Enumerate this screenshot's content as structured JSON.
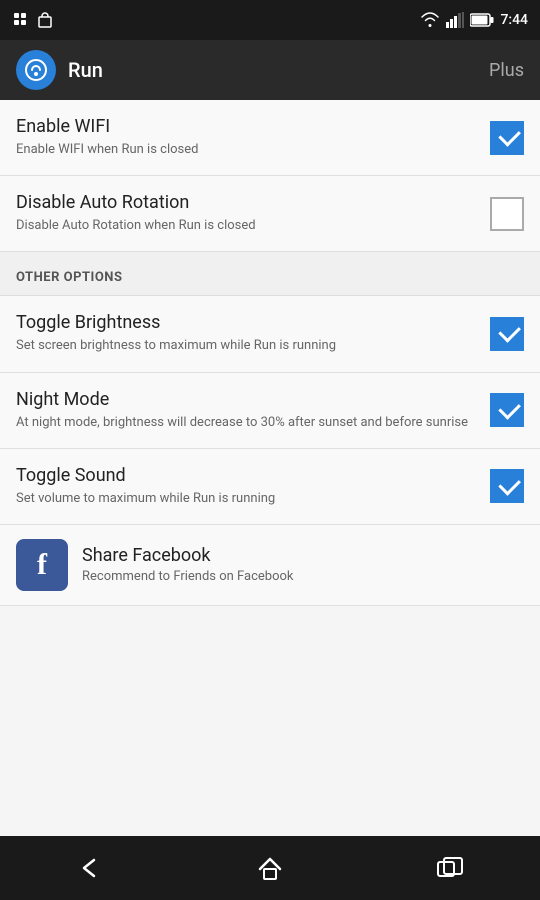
{
  "statusBar": {
    "time": "7:44"
  },
  "appBar": {
    "appName": "Run",
    "section": "Plus"
  },
  "settings": [
    {
      "id": "enable-wifi",
      "title": "Enable WIFI",
      "description": "Enable WIFI when Run         is closed",
      "checked": true
    },
    {
      "id": "disable-rotation",
      "title": "Disable Auto Rotation",
      "description": "Disable Auto Rotation when Run         is closed",
      "checked": false
    }
  ],
  "sectionHeader": {
    "label": "OTHER OPTIONS"
  },
  "otherOptions": [
    {
      "id": "toggle-brightness",
      "title": "Toggle Brightness",
      "description": "Set screen brightness to maximum while Run         is running",
      "checked": true
    },
    {
      "id": "night-mode",
      "title": "Night Mode",
      "description": "At night mode, brightness will decrease to 30% after sunset and before sunrise",
      "checked": true
    },
    {
      "id": "toggle-sound",
      "title": "Toggle Sound",
      "description": "Set volume to maximum while Run         is running",
      "checked": true
    }
  ],
  "facebook": {
    "title": "Share Facebook",
    "description": "Recommend to Friends on Facebook"
  }
}
